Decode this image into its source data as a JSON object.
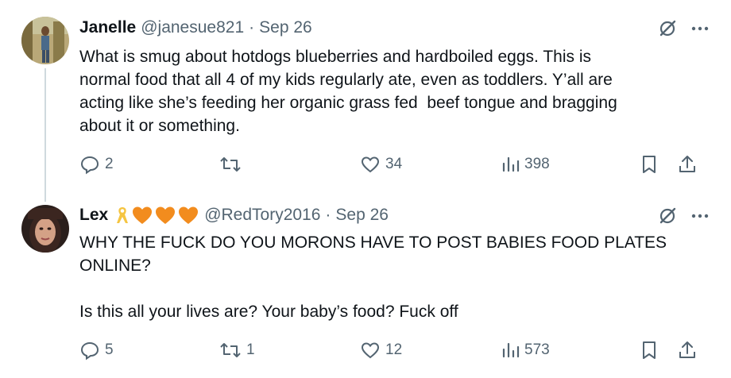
{
  "tweets": [
    {
      "name": "Janelle",
      "handle": "@janesue821",
      "separator": "·",
      "date": "Sep 26",
      "text": "What is smug about hotdogs blueberries and hardboiled eggs. This is\nnormal food that all 4 of my kids regularly ate, even as toddlers. Y’all are\nacting like she’s feeding her organic grass fed  beef tongue and bragging\nabout it or something.",
      "replies": "2",
      "retweets": "",
      "likes": "34",
      "views": "398"
    },
    {
      "name": "Lex",
      "handle": "@RedTory2016",
      "separator": "·",
      "date": "Sep 26",
      "text": "WHY THE FUCK DO YOU MORONS HAVE TO POST BABIES FOOD PLATES\nONLINE?\n\nIs this all your lives are? Your baby’s food? Fuck off",
      "replies": "5",
      "retweets": "1",
      "likes": "12",
      "views": "573",
      "name_emojis": [
        "yellow-ribbon",
        "orange-heart",
        "orange-heart",
        "orange-heart"
      ]
    }
  ],
  "colors": {
    "text": "#0f1419",
    "secondary": "#536471",
    "heart": "#f28c1e",
    "ribbon": "#f5c542",
    "line": "#cfd9de"
  }
}
